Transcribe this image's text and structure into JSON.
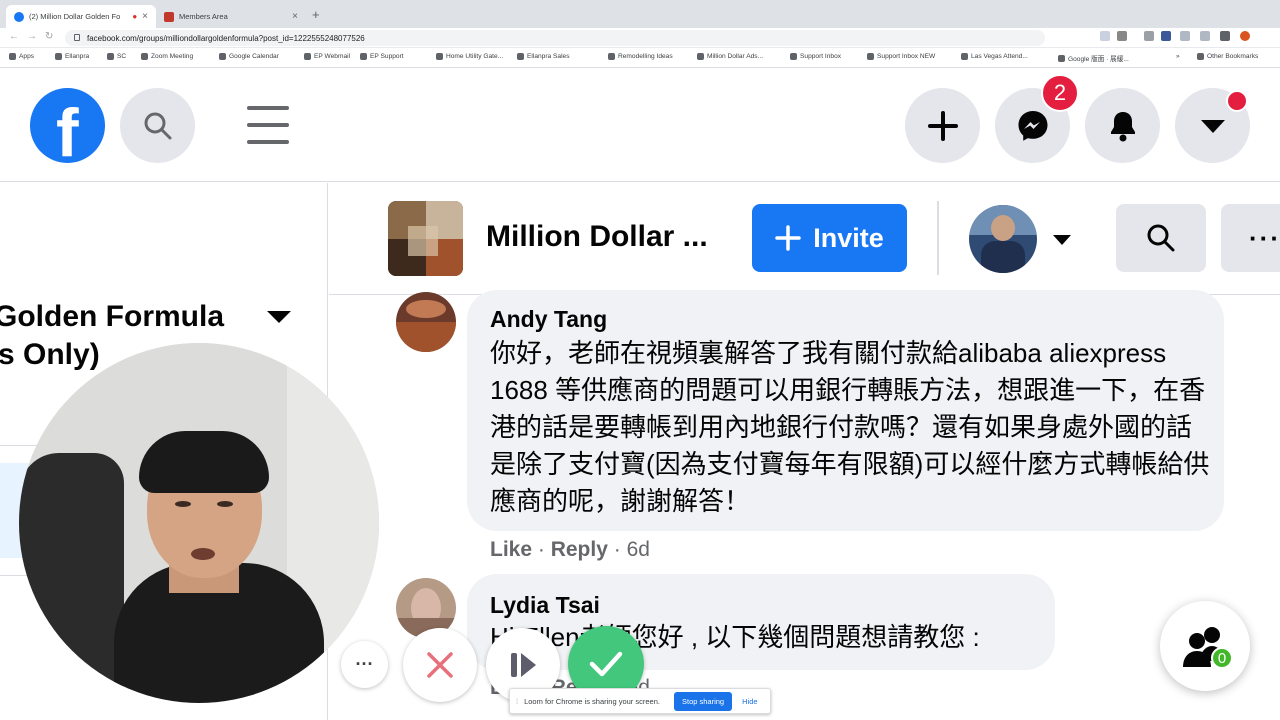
{
  "browser": {
    "tabs": [
      {
        "title": "(2) Million Dollar Golden Fo",
        "active": true
      },
      {
        "title": "Members Area",
        "active": false
      }
    ],
    "url": "facebook.com/groups/milliondollargoldenformula?post_id=1222555248077526",
    "bookmarks": [
      "Apps",
      "Ellanpra",
      "SC",
      "Zoom Meeting",
      "Google Calendar",
      "EP Webmail",
      "EP Support",
      "Home Utility Gate...",
      "Ellanpra Sales",
      "Remodelling Ideas",
      "Million Dollar Ads...",
      "Support Inbox",
      "Support Inbox NEW",
      "Las Vegas Attend...",
      "Google 版面 · 展緩...",
      "»",
      "Other Bookmarks"
    ]
  },
  "header": {
    "messenger_badge": "2",
    "logo_letter": "f"
  },
  "left_panel": {
    "group_name_line1": "Golden Formula",
    "group_name_line2": "s Only)"
  },
  "group_bar": {
    "title": "Million Dollar ...",
    "invite_label": "Invite"
  },
  "comments": [
    {
      "author": "Andy Tang",
      "text": "你好，老師在視頻裏解答了我有關付款給alibaba aliexpress 1688 等供應商的問題可以用銀行轉賬方法，想跟進一下，在香港的話是要轉帳到用內地銀行付款嗎？還有如果身處外國的話是除了支付寶(因為支付寶每年有限額)可以經什麼方式轉帳給供應商的呢，謝謝解答！",
      "like_label": "Like",
      "reply_label": "Reply",
      "time": "6d"
    },
    {
      "author": "Lydia Tsai",
      "text": "Hi Ellen老師您好 , 以下幾個問題想請教您 :",
      "like_label": "Like",
      "reply_label": "Reply",
      "time": "6d"
    }
  ],
  "loom": {
    "share_notice": "Loom for Chrome is sharing your screen.",
    "stop_label": "Stop sharing",
    "hide_label": "Hide"
  },
  "friends_online": "0",
  "colors": {
    "fb_blue": "#1877f2",
    "badge_red": "#e41e3f",
    "loom_green": "#42c77c",
    "bubble_gray": "#f0f2f5"
  }
}
